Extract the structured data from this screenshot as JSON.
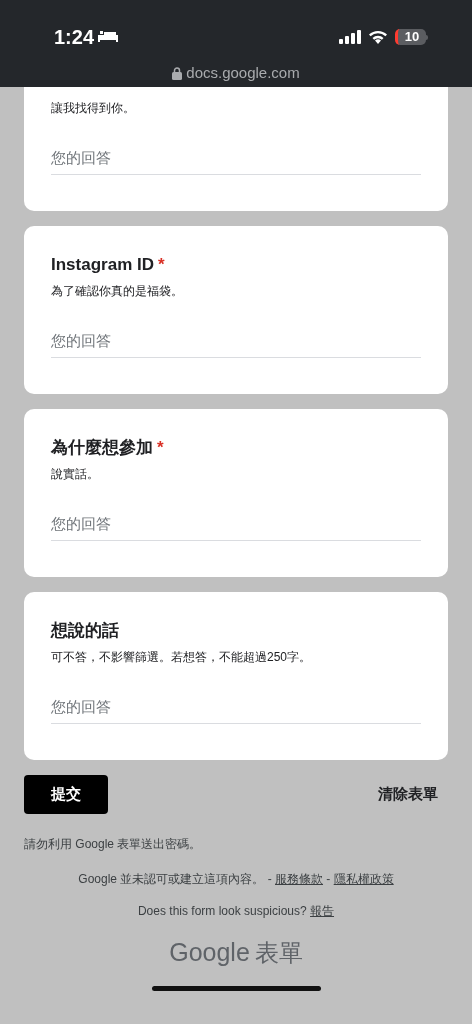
{
  "status_bar": {
    "time": "1:24",
    "battery": "10"
  },
  "url": "docs.google.com",
  "questions": [
    {
      "description": "讓我找得到你。",
      "placeholder": "您的回答"
    },
    {
      "title": "Instagram ID",
      "required": true,
      "description": "為了確認你真的是福袋。",
      "placeholder": "您的回答"
    },
    {
      "title": "為什麼想參加",
      "required": true,
      "description": "說實話。",
      "placeholder": "您的回答"
    },
    {
      "title": "想說的話",
      "required": false,
      "description": "可不答，不影響篩選。若想答，不能超過250字。",
      "placeholder": "您的回答"
    }
  ],
  "required_mark": "*",
  "submit_button": "提交",
  "clear_button": "清除表單",
  "password_warning": "請勿利用 Google 表單送出密碼。",
  "disclaimer": [
    {
      "kind": "text",
      "text": "Google 並未認可或建立這項內容。 - "
    },
    {
      "kind": "link",
      "text": "服務條款"
    },
    {
      "kind": "text",
      "text": " - "
    },
    {
      "kind": "link",
      "text": "隱私權政策"
    }
  ],
  "report": [
    {
      "kind": "text",
      "text": "Does this form look suspicious? "
    },
    {
      "kind": "link",
      "text": "報告"
    }
  ],
  "brand": {
    "google": "Google",
    "product": "表單"
  }
}
